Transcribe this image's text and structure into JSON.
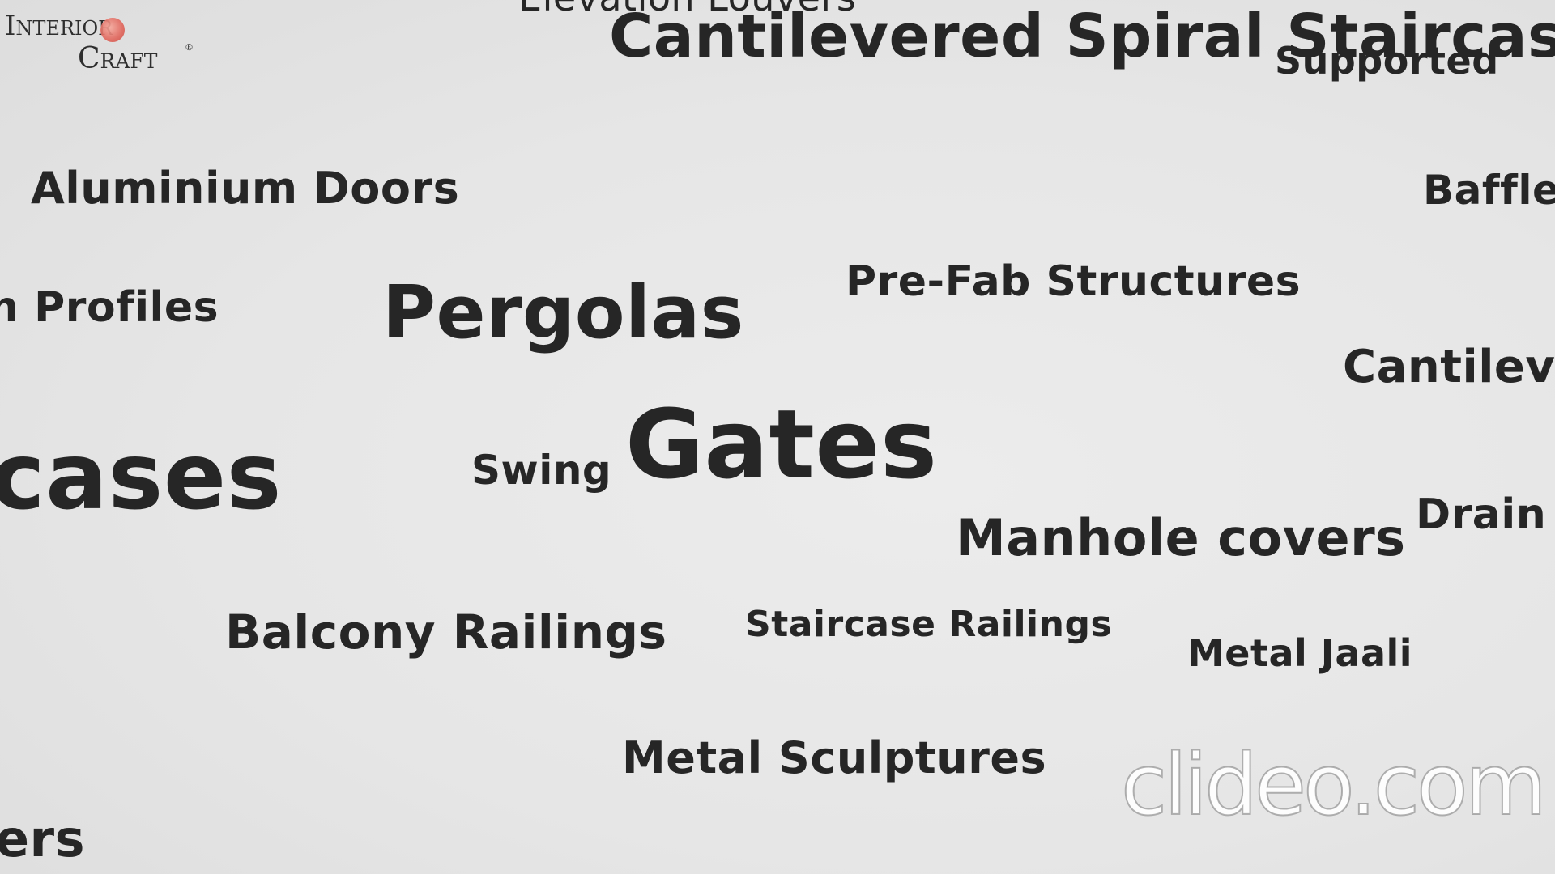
{
  "logo": {
    "line1": "Interior",
    "line2": "Craft",
    "registered": "®"
  },
  "words": {
    "elevation_louvers": "Elevation Louvers",
    "cantilevered_spiral": "Cantilevered Spiral Staircase",
    "supported": "Supported",
    "aluminium_doors": "Aluminium Doors",
    "baffle": "Baffle",
    "profiles": "n Profiles",
    "pergolas": "Pergolas",
    "prefab": "Pre-Fab Structures",
    "cantilev": "Cantilev",
    "cases": "cases",
    "swing": "Swing",
    "gates": "Gates",
    "manhole": "Manhole covers",
    "drain": "Drain",
    "balcony": "Balcony Railings",
    "staircase_railings": "Staircase Railings",
    "metal_jaali": "Metal Jaali",
    "metal_sculptures": "Metal Sculptures",
    "ers": "ers"
  },
  "watermark": "clideo.com",
  "colors": {
    "text": "#262626",
    "background": "#e6e6e6",
    "logo_accent": "#e0645a"
  }
}
